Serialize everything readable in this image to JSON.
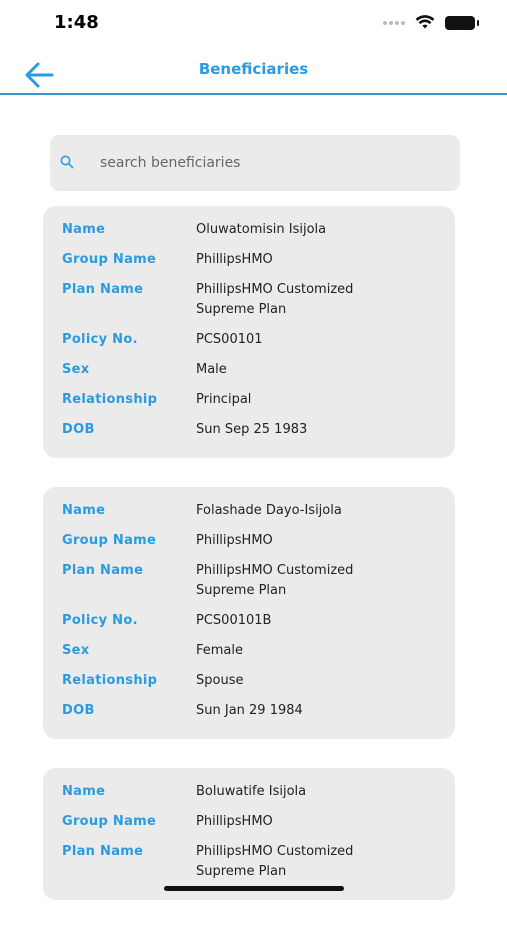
{
  "status_bar": {
    "time": "1:48"
  },
  "header": {
    "title": "Beneficiaries"
  },
  "search": {
    "placeholder": "search beneficiaries",
    "value": ""
  },
  "labels": {
    "name": "Name",
    "group_name": "Group Name",
    "plan_name": "Plan Name",
    "policy_no": "Policy No.",
    "sex": "Sex",
    "relationship": "Relationship",
    "dob": "DOB"
  },
  "beneficiaries": [
    {
      "name": "Oluwatomisin Isijola",
      "group_name": "PhillipsHMO",
      "plan_name": "PhillipsHMO Customized Supreme Plan",
      "policy_no": "PCS00101",
      "sex": "Male",
      "relationship": "Principal",
      "dob": "Sun Sep 25 1983"
    },
    {
      "name": "Folashade Dayo-Isijola",
      "group_name": "PhillipsHMO",
      "plan_name": "PhillipsHMO Customized Supreme Plan",
      "policy_no": "PCS00101B",
      "sex": "Female",
      "relationship": "Spouse",
      "dob": "Sun Jan 29 1984"
    },
    {
      "name": "Boluwatife Isijola",
      "group_name": "PhillipsHMO",
      "plan_name": "PhillipsHMO Customized Supreme Plan"
    }
  ],
  "colors": {
    "accent": "#2a9be0",
    "card_bg": "#ebebeb"
  }
}
